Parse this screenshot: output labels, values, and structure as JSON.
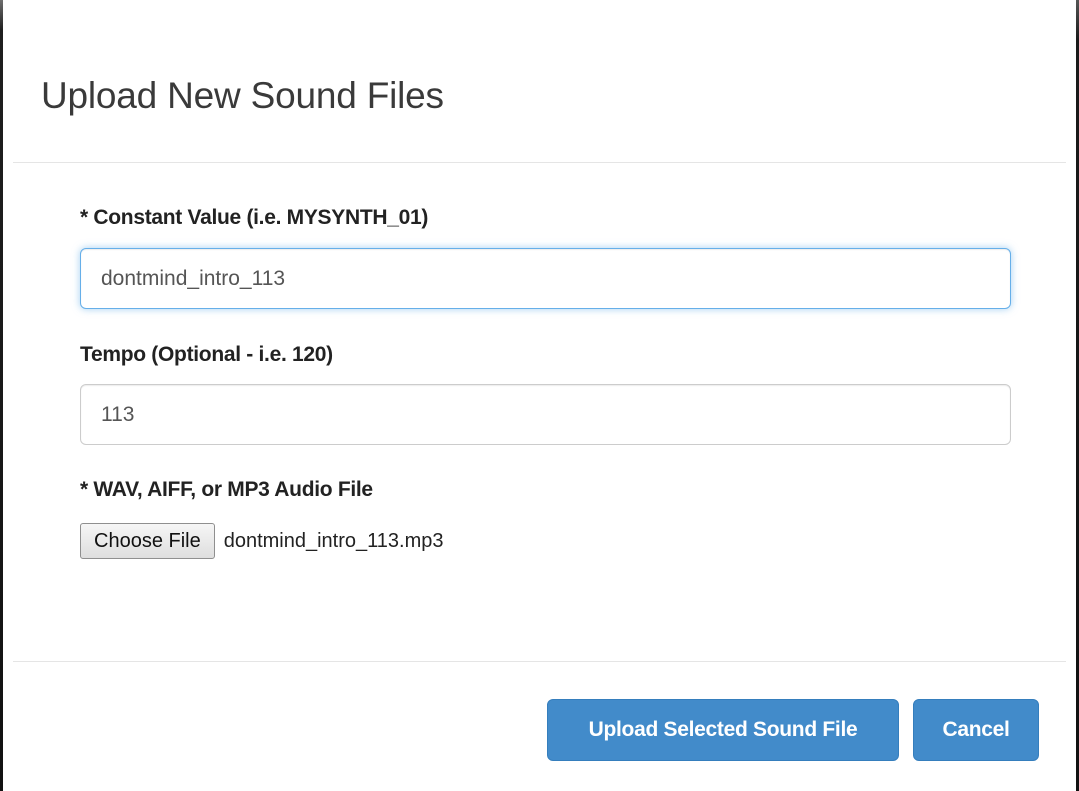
{
  "dialog": {
    "title": "Upload New Sound Files"
  },
  "form": {
    "constant": {
      "label": "* Constant Value (i.e. MYSYNTH_01)",
      "value": "dontmind_intro_113"
    },
    "tempo": {
      "label": "Tempo (Optional - i.e. 120)",
      "value": "113"
    },
    "audio_file": {
      "label": "* WAV, AIFF, or MP3 Audio File",
      "button_label": "Choose File",
      "selected_file": "dontmind_intro_113.mp3"
    }
  },
  "footer": {
    "upload_label": "Upload Selected Sound File",
    "cancel_label": "Cancel"
  },
  "colors": {
    "primary": "#428bca",
    "focus_border": "#66afe9",
    "divider": "#e5e5e5"
  }
}
